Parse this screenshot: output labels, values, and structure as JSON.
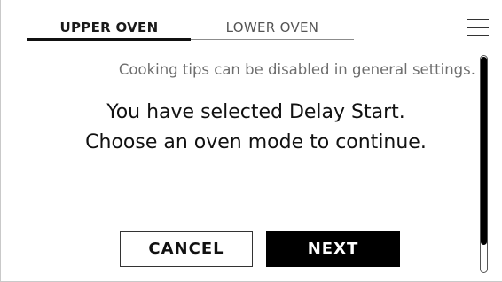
{
  "tabs": {
    "upper_label": "UPPER OVEN",
    "lower_label": "LOWER OVEN",
    "active": "UPPER OVEN"
  },
  "menu": {
    "icon": "hamburger-menu-icon"
  },
  "content": {
    "tip": "Cooking tips can be disabled in general settings.",
    "message_line1": "You have selected Delay Start.",
    "message_line2": "Choose an oven mode to continue."
  },
  "actions": {
    "cancel_label": "CANCEL",
    "next_label": "NEXT"
  },
  "colors": {
    "primary_button_bg": "#000000",
    "primary_button_text": "#ffffff",
    "tip_text": "#6e6e6e",
    "message_text": "#111111"
  }
}
